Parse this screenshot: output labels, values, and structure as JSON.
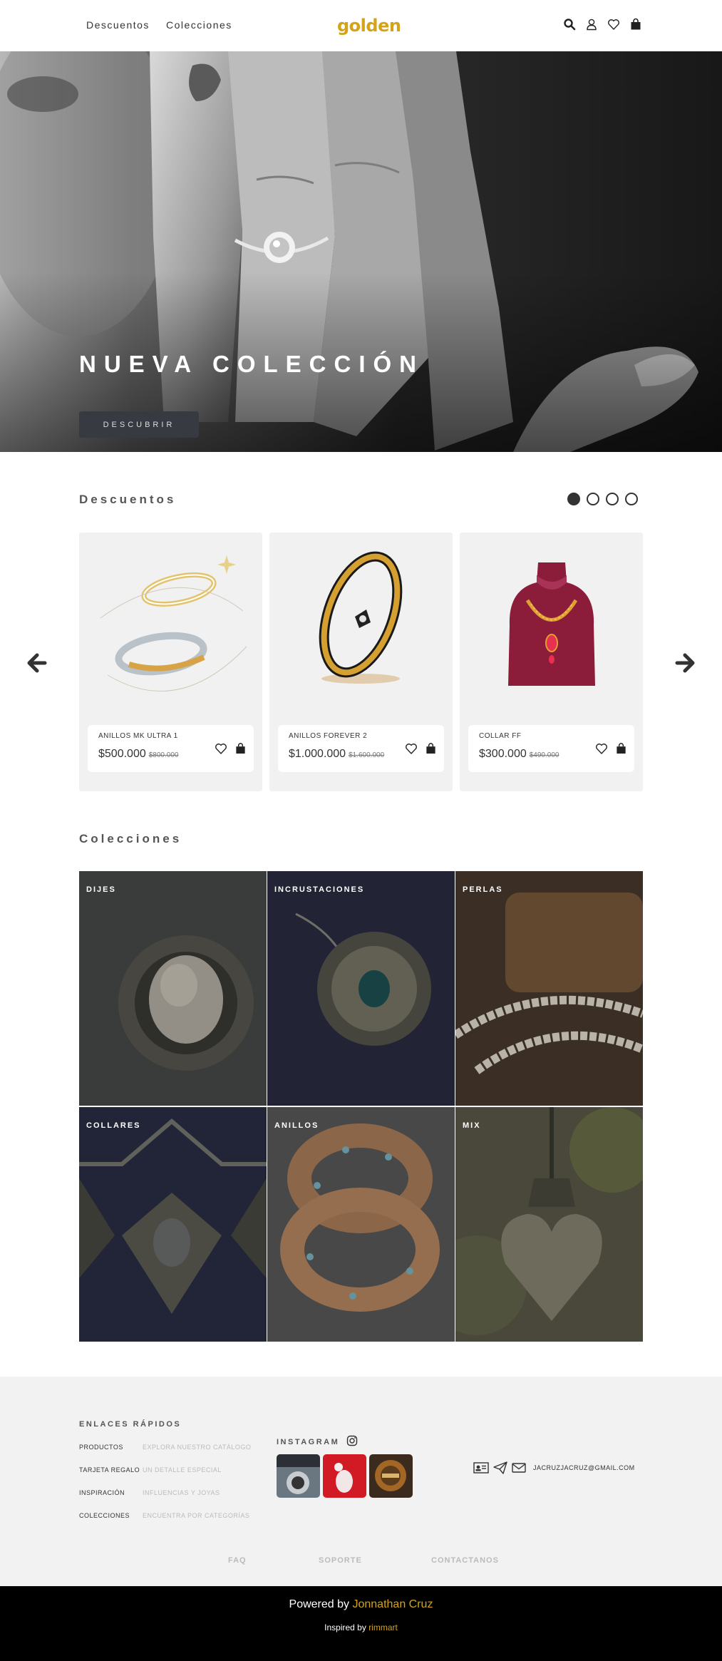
{
  "nav": {
    "links": [
      "Descuentos",
      "Colecciones"
    ],
    "logo": "golden",
    "icons": [
      "search-icon",
      "user-icon",
      "heart-icon",
      "bag-icon"
    ]
  },
  "hero": {
    "title": "NUEVA COLECCIÓN",
    "button": "DESCUBRIR"
  },
  "discounts": {
    "title": "Descuentos",
    "slides": 4,
    "active_slide": 1,
    "products": [
      {
        "name": "ANILLOS MK ULTRA 1",
        "price": "$500.000",
        "old_price": "$800.000"
      },
      {
        "name": "ANILLOS FOREVER 2",
        "price": "$1.000.000",
        "old_price": "$1.600.000"
      },
      {
        "name": "COLLAR FF",
        "price": "$300.000",
        "old_price": "$490.000"
      }
    ]
  },
  "collections": {
    "title": "Colecciones",
    "items": [
      "DIJES",
      "INCRUSTACIONES",
      "PERLAS",
      "COLLARES",
      "ANILLOS",
      "MIX"
    ]
  },
  "footer": {
    "quick_links_title": "ENLACES RÁPIDOS",
    "quick_links": [
      {
        "label": "PRODUCTOS",
        "desc": "EXPLORA NUESTRO CATÁLOGO"
      },
      {
        "label": "TARJETA REGALO",
        "desc": "UN DETALLE ESPECIAL"
      },
      {
        "label": "INSPIRACIÓN",
        "desc": "INFLUENCIAS Y JOYAS"
      },
      {
        "label": "COLECCIONES",
        "desc": "ENCUENTRA POR CATEGORÍAS"
      }
    ],
    "instagram_title": "INSTAGRAM",
    "email": "JACRUZJACRUZ@GMAIL.COM",
    "bottom_links": [
      "FAQ",
      "SOPORTE",
      "CONTACTANOS"
    ],
    "powered_prefix": "Powered by",
    "powered_name": "Jonnathan Cruz",
    "inspired_prefix": "Inspired by",
    "inspired_name": "rimmart"
  },
  "colors": {
    "accent": "#d4a418",
    "dark": "#383a42",
    "footer_bg": "#f2f2f2"
  }
}
